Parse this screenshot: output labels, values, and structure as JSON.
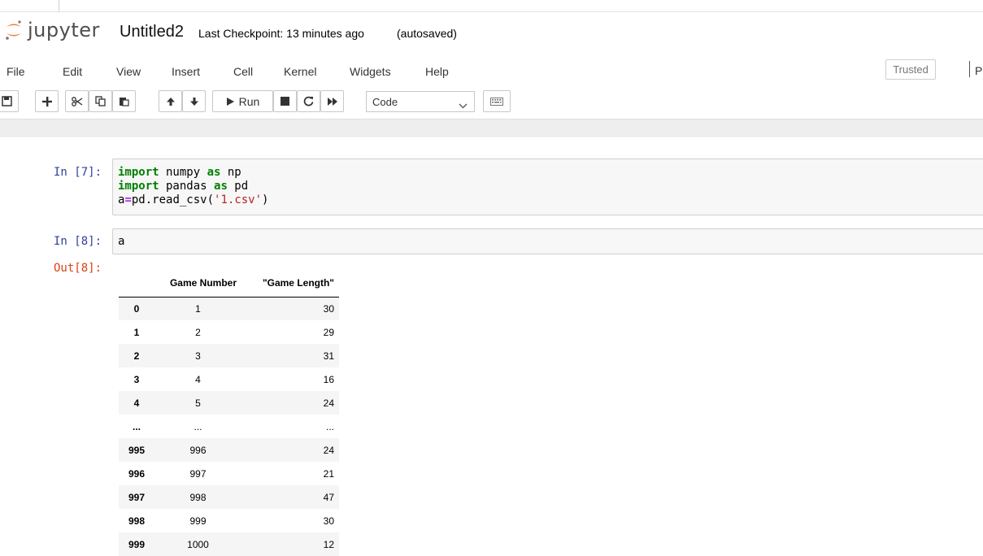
{
  "app": {
    "logo_text": "jupyter",
    "notebook_name": "Untitled2",
    "checkpoint": "Last Checkpoint: 13 minutes ago",
    "autosave_status": "(autosaved)"
  },
  "menu": {
    "items": [
      "File",
      "Edit",
      "View",
      "Insert",
      "Cell",
      "Kernel",
      "Widgets",
      "Help"
    ],
    "trusted_label": "Trusted",
    "right_clipped_text": "P"
  },
  "toolbar": {
    "run_label": "Run",
    "cell_type": "Code",
    "icons": [
      "save-icon",
      "plus-icon",
      "cut-icon",
      "copy-icon",
      "paste-icon",
      "arrow-up-icon",
      "arrow-down-icon",
      "play-icon",
      "stop-icon",
      "restart-icon",
      "fast-forward-icon",
      "keyboard-icon"
    ]
  },
  "cells": [
    {
      "prompt": "In [7]:",
      "lines": [
        [
          {
            "t": "import",
            "c": "kw"
          },
          {
            "t": " numpy ",
            "c": ""
          },
          {
            "t": "as",
            "c": "kw"
          },
          {
            "t": " np",
            "c": ""
          }
        ],
        [
          {
            "t": "import",
            "c": "kw"
          },
          {
            "t": " pandas ",
            "c": ""
          },
          {
            "t": "as",
            "c": "kw"
          },
          {
            "t": " pd",
            "c": ""
          }
        ],
        [
          {
            "t": "a",
            "c": ""
          },
          {
            "t": "=",
            "c": "op"
          },
          {
            "t": "pd.read_csv(",
            "c": ""
          },
          {
            "t": "'1.csv'",
            "c": "str"
          },
          {
            "t": ")",
            "c": ""
          }
        ]
      ]
    },
    {
      "prompt": "In [8]:",
      "lines": [
        [
          {
            "t": "a",
            "c": ""
          }
        ]
      ],
      "out_prompt": "Out[8]:"
    }
  ],
  "dataframe": {
    "columns": [
      "",
      "Game Number",
      "\"Game Length\""
    ],
    "rows": [
      [
        "0",
        "1",
        "30"
      ],
      [
        "1",
        "2",
        "29"
      ],
      [
        "2",
        "3",
        "31"
      ],
      [
        "3",
        "4",
        "16"
      ],
      [
        "4",
        "5",
        "24"
      ],
      [
        "...",
        "...",
        "..."
      ],
      [
        "995",
        "996",
        "24"
      ],
      [
        "996",
        "997",
        "21"
      ],
      [
        "997",
        "998",
        "47"
      ],
      [
        "998",
        "999",
        "30"
      ],
      [
        "999",
        "1000",
        "12"
      ]
    ]
  },
  "colors": {
    "prompt_in": "#303f9f",
    "prompt_out": "#d84315",
    "keyword": "#008000",
    "string": "#ba2121",
    "logo_orange": "#f37726"
  }
}
